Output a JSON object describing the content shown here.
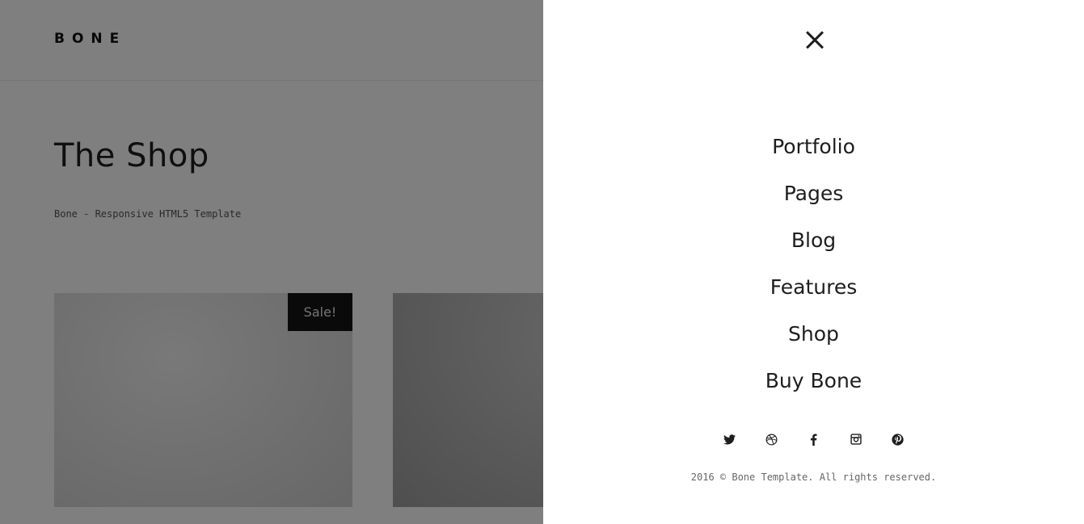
{
  "header": {
    "logo": "BONE"
  },
  "hero": {
    "title": "The Shop",
    "subtitle": "Bone - Responsive HTML5 Template"
  },
  "products": [
    {
      "badge": "Sale!"
    }
  ],
  "menu": {
    "close_icon": "close-icon",
    "items": [
      {
        "label": "Portfolio"
      },
      {
        "label": "Pages"
      },
      {
        "label": "Blog"
      },
      {
        "label": "Features"
      },
      {
        "label": "Shop"
      },
      {
        "label": "Buy Bone"
      }
    ],
    "social": [
      "twitter-icon",
      "dribbble-icon",
      "facebook-icon",
      "instagram-icon",
      "pinterest-icon"
    ],
    "copyright": "2016 © Bone Template. All rights reserved."
  },
  "colors": {
    "text": "#1e1e1e",
    "badge_bg": "#141414",
    "overlay": "rgba(0,0,0,0.5)"
  }
}
